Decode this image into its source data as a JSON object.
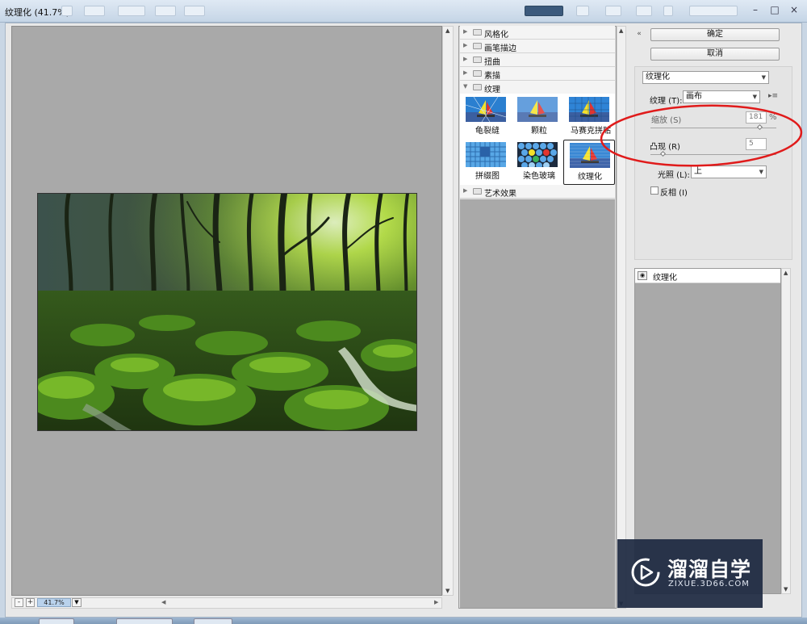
{
  "window": {
    "title": "纹理化 (41.7%)"
  },
  "gallery": {
    "categories_top": [
      "风格化",
      "画笔描边",
      "扭曲",
      "素描"
    ],
    "open_category": "纹理",
    "thumbnails": [
      "龟裂缝",
      "颗粒",
      "马赛克拼贴",
      "拼缀图",
      "染色玻璃",
      "纹理化"
    ],
    "selected_thumbnail": "纹理化",
    "categories_bottom": [
      "艺术效果"
    ]
  },
  "buttons": {
    "ok": "确定",
    "cancel": "取消"
  },
  "settings": {
    "filter_select": "纹理化",
    "texture_label": "纹理 (T):",
    "texture_value": "画布",
    "scale_label": "缩放 (S)",
    "scale_value": "181",
    "scale_unit": "%",
    "scale_level": 181,
    "scale_range": [
      50,
      200
    ],
    "relief_label": "凸现 (R)",
    "relief_value": "5",
    "relief_level": 5,
    "relief_range": [
      0,
      50
    ],
    "light_label": "光照 (L):",
    "light_value": "上",
    "invert_label": "反相 (I)",
    "invert_checked": false
  },
  "layers": {
    "items": [
      "纹理化"
    ]
  },
  "status": {
    "zoom": "41.7%",
    "zoom_minus": "-",
    "zoom_plus": "+"
  },
  "watermark": {
    "brand": "溜溜自学",
    "url": "ZIXUE.3D66.COM"
  },
  "colors": {
    "annotation_circle": "#e01b1b",
    "canvas_bg": "#a9a9a9",
    "watermark_bg": "#1e2a42",
    "zoom_highlight": "#b9d2ec"
  }
}
